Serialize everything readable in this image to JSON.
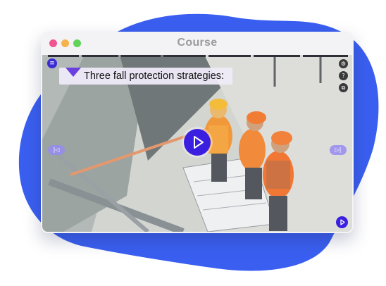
{
  "window": {
    "title": "Course"
  },
  "caption": {
    "text": "Three fall protection strategies:"
  },
  "controls": {
    "menu_icon": "menu-icon",
    "side_icons": [
      "settings-icon",
      "help-icon",
      "captions-icon"
    ],
    "side_glyphs": [
      "⚙",
      "?",
      "⧉"
    ],
    "prev_glyph": "|◁",
    "next_glyph": "▷|",
    "menu_glyph": "≡"
  },
  "colors": {
    "accent": "#3b1fe0",
    "blob": "#3a5ff0",
    "caption_marker": "#6b3fe0"
  }
}
